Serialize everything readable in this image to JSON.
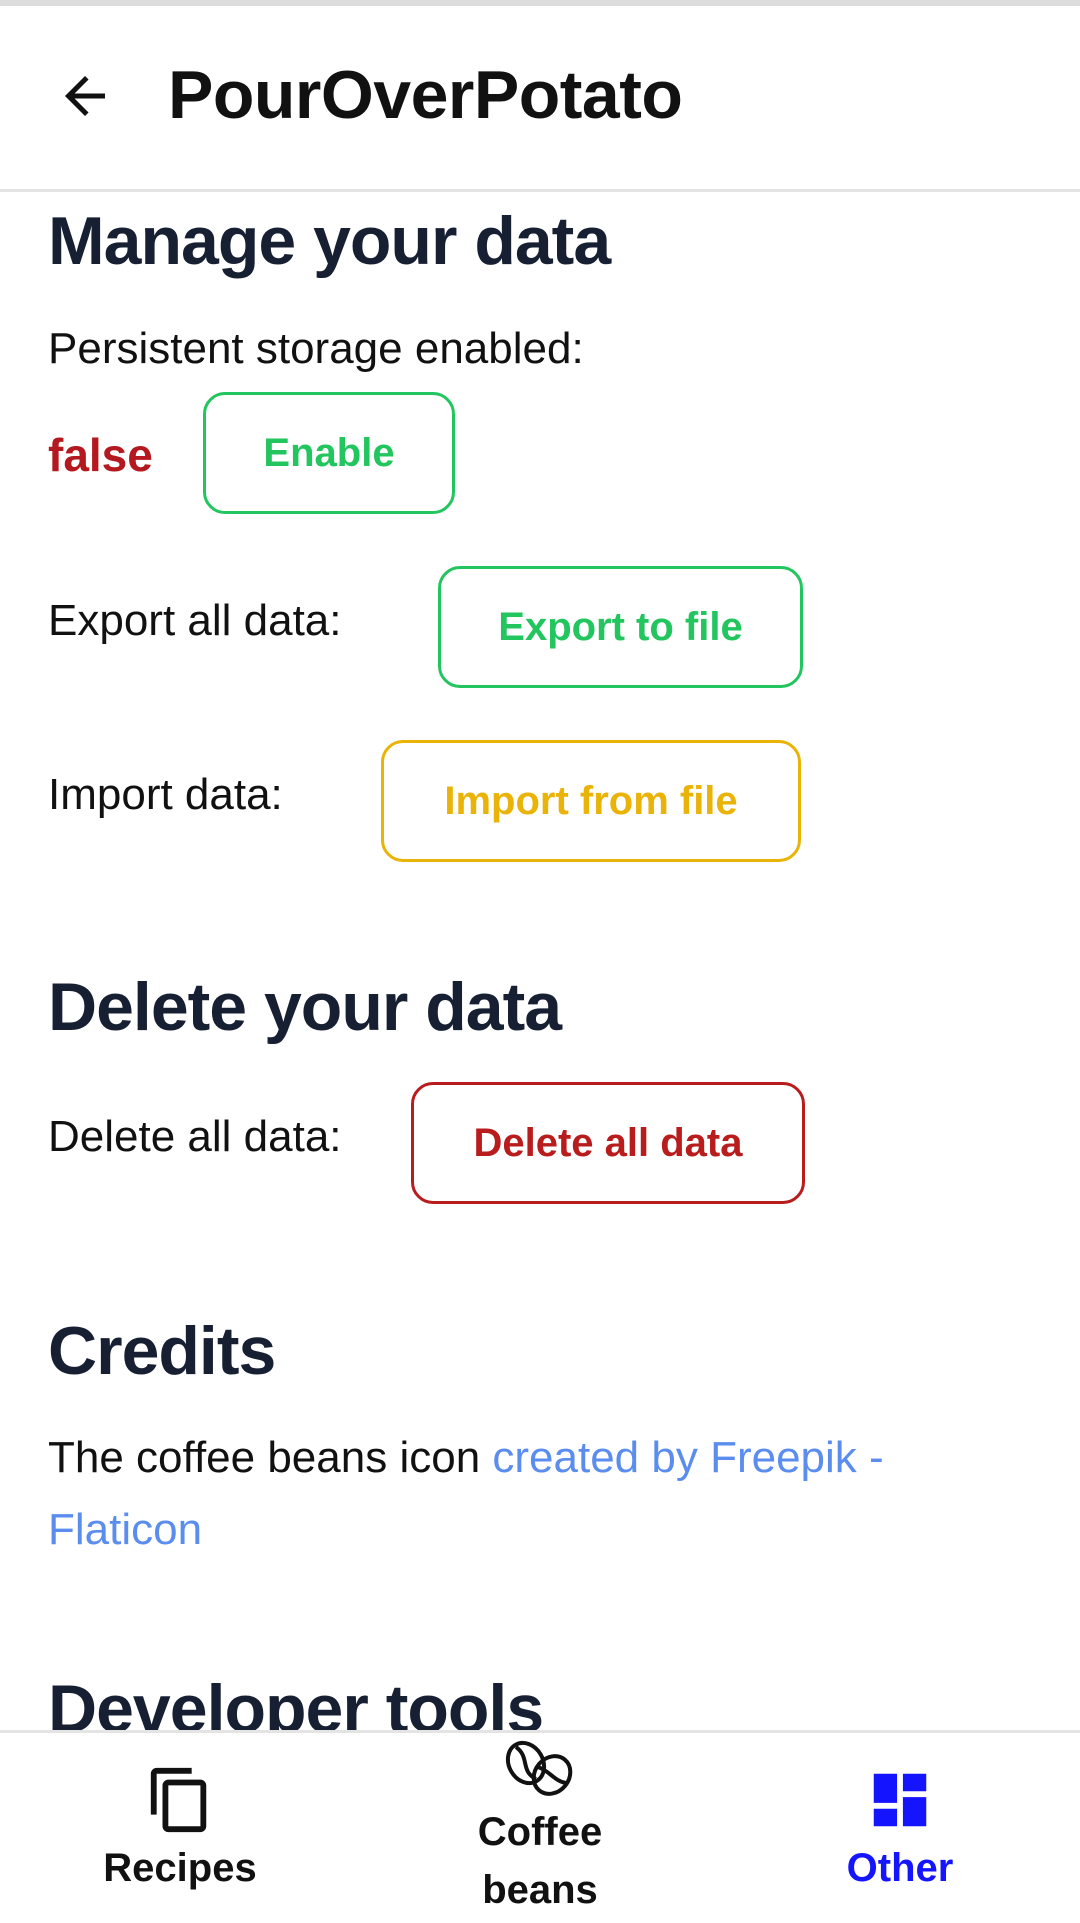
{
  "app_bar": {
    "back_icon": "arrow-left-icon",
    "title": "PourOverPotato"
  },
  "manage": {
    "title": "Manage your data",
    "persistent_label": "Persistent storage enabled:",
    "persistent_value": "false",
    "enable_button": "Enable",
    "export_label": "Export all data:",
    "export_button": "Export to file",
    "import_label": "Import data:",
    "import_button": "Import from file"
  },
  "delete": {
    "title": "Delete your data",
    "label": "Delete all data:",
    "button": "Delete all data"
  },
  "credits": {
    "title": "Credits",
    "text": "The coffee beans icon ",
    "link": "created by Freepik - Flaticon"
  },
  "developer": {
    "title": "Developer tools"
  },
  "bottom_nav": {
    "items": [
      {
        "label": "Recipes",
        "icon": "copy-icon",
        "active": false
      },
      {
        "label": "Coffee beans",
        "icon": "coffee-beans-icon",
        "active": false
      },
      {
        "label": "Other",
        "icon": "dashboard-icon",
        "active": true
      }
    ]
  },
  "colors": {
    "green": "#22c55e",
    "yellow": "#eab308",
    "red": "#b91c1c",
    "link": "#5b8def",
    "active_nav": "#1414ff",
    "heading": "#172033"
  }
}
